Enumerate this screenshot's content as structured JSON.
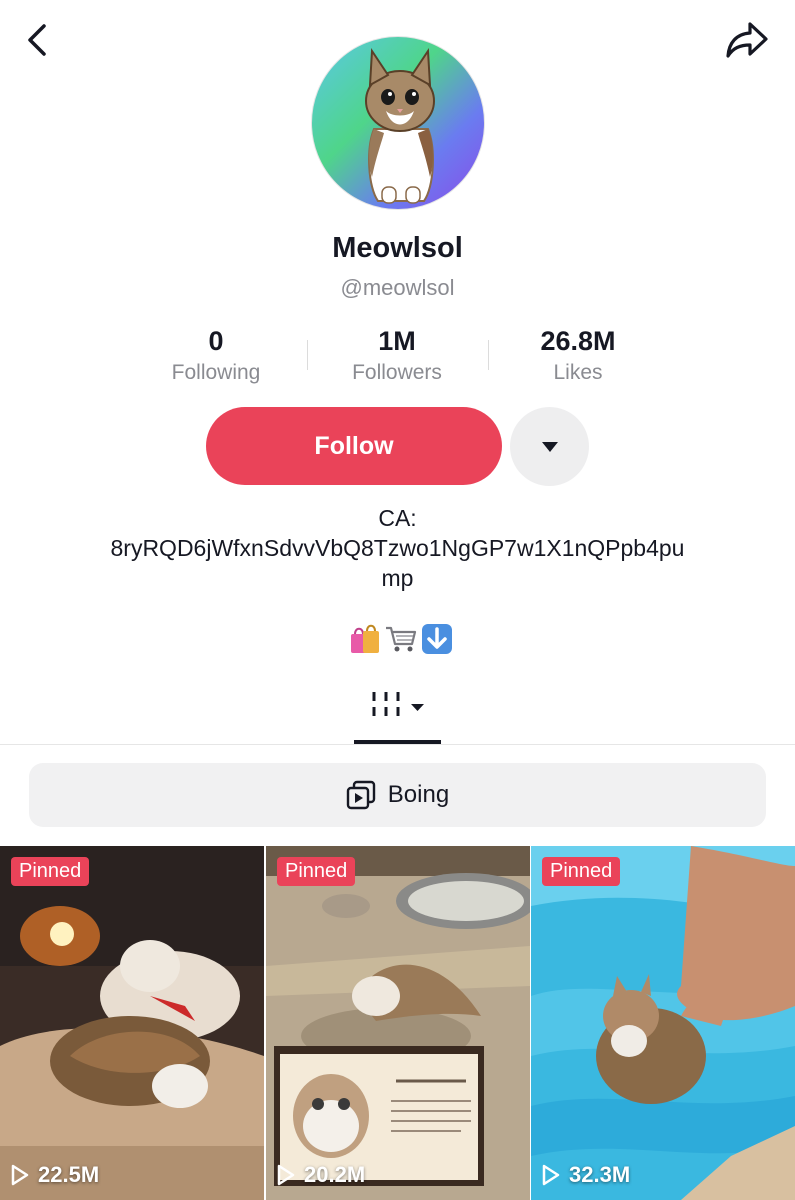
{
  "profile": {
    "display_name": "Meowlsol",
    "username": "@meowlsol",
    "avatar_icon": "cat-icon"
  },
  "stats": {
    "following": {
      "value": "0",
      "label": "Following"
    },
    "followers": {
      "value": "1M",
      "label": "Followers"
    },
    "likes": {
      "value": "26.8M",
      "label": "Likes"
    }
  },
  "actions": {
    "follow_label": "Follow",
    "more_icon": "caret-down-icon"
  },
  "bio": {
    "line1": "CA:",
    "line2": "8ryRQD6jWfxnSdvvVbQ8Tzwo1NgGP7w1X1nQPpb4pu",
    "line3": "mp",
    "emojis": [
      "shopping-bags-icon",
      "shopping-cart-icon",
      "down-arrow-icon"
    ]
  },
  "tabs": {
    "active_icon": "videos-grid-icon"
  },
  "playlist": {
    "label": "Boing"
  },
  "videos": [
    {
      "badge": "Pinned",
      "views": "22.5M"
    },
    {
      "badge": "Pinned",
      "views": "20.2M"
    },
    {
      "badge": "Pinned",
      "views": "32.3M"
    }
  ],
  "colors": {
    "accent": "#ea4359",
    "text_primary": "#161823",
    "text_secondary": "#8a8b91"
  }
}
